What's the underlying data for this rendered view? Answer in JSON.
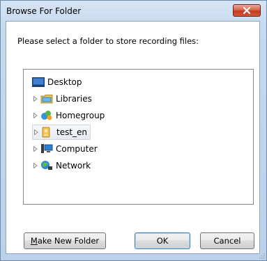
{
  "window": {
    "title": "Browse For Folder"
  },
  "dialog": {
    "prompt": "Please select a folder to store recording files:"
  },
  "tree": {
    "items": [
      {
        "label": "Desktop",
        "icon": "desktop-icon",
        "expandable": false
      },
      {
        "label": "Libraries",
        "icon": "libraries-icon",
        "expandable": true
      },
      {
        "label": "Homegroup",
        "icon": "homegroup-icon",
        "expandable": true
      },
      {
        "label": "test_en",
        "icon": "user-folder-icon",
        "expandable": true,
        "selected": true
      },
      {
        "label": "Computer",
        "icon": "computer-icon",
        "expandable": true
      },
      {
        "label": "Network",
        "icon": "network-icon",
        "expandable": true
      }
    ]
  },
  "buttons": {
    "make_new_folder_underline": "M",
    "make_new_folder_rest": "ake New Folder",
    "ok": "OK",
    "cancel": "Cancel"
  },
  "colors": {
    "titlebar": "#c5d9ef",
    "close_button": "#c23b22",
    "selection": "#e6ebf1"
  }
}
